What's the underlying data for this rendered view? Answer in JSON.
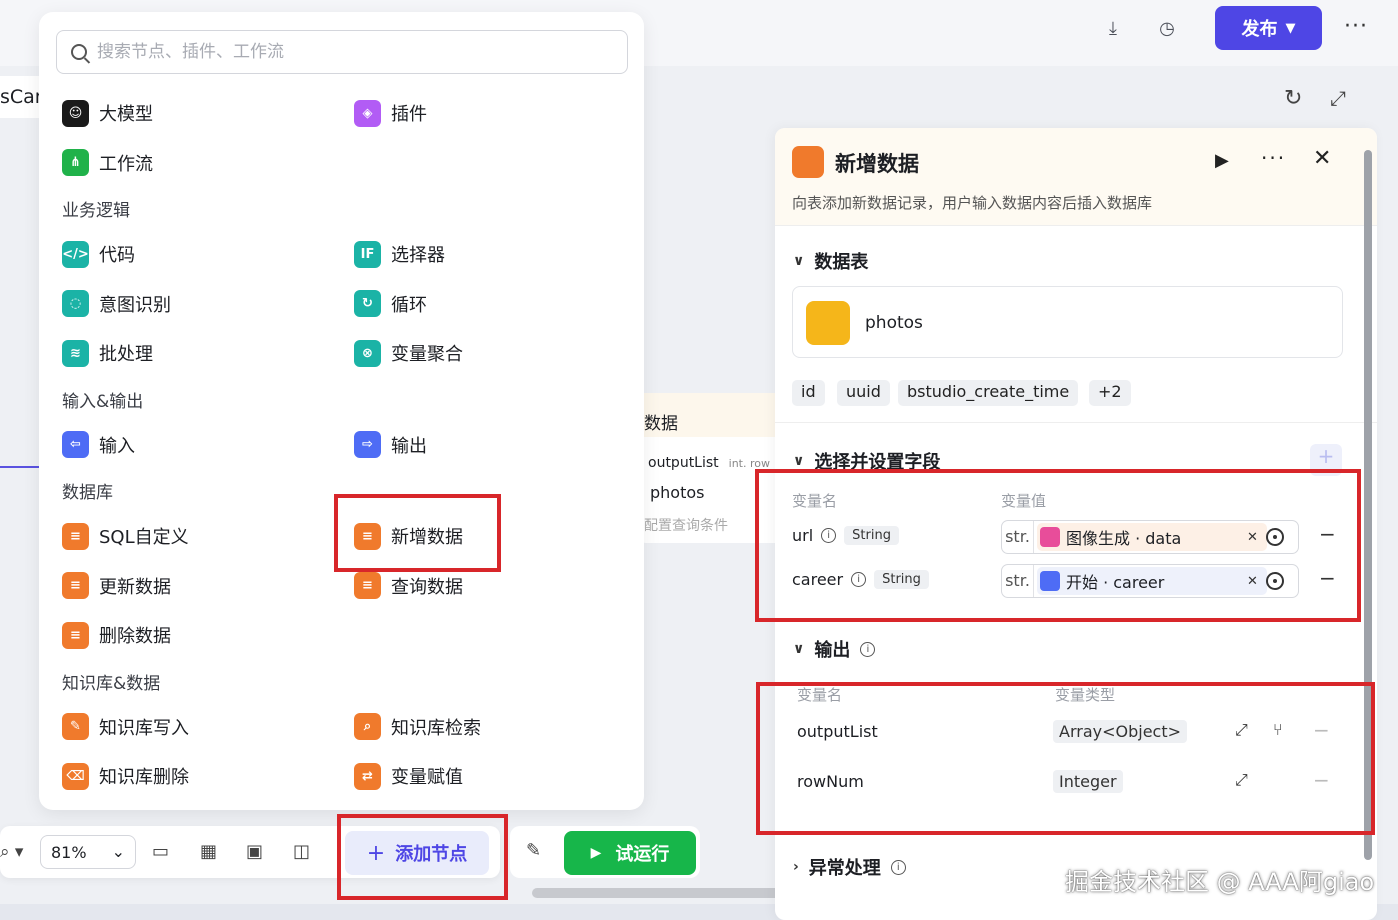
{
  "topbar": {
    "publish_label": "发布",
    "more": "···",
    "icons": [
      "save-draft-icon",
      "history-icon"
    ]
  },
  "canvas": {
    "left_node_fragment": "sCar",
    "mid_node": {
      "title_fragment": "数据",
      "output": "outputList",
      "output_type": "int. row",
      "table": "photos",
      "hint": "配置查询条件"
    }
  },
  "node_menu": {
    "search_placeholder": "搜索节点、插件、工作流",
    "top": [
      {
        "label": "大模型",
        "icon": "llm-icon",
        "glyph": "☺",
        "color": "c-black"
      },
      {
        "label": "插件",
        "icon": "plugin-icon",
        "glyph": "◈",
        "color": "c-purple"
      },
      {
        "label": "工作流",
        "icon": "workflow-icon",
        "glyph": "⋔",
        "color": "c-green"
      }
    ],
    "sections": [
      {
        "title": "业务逻辑",
        "items": [
          {
            "label": "代码",
            "icon": "code-icon",
            "glyph": "</>",
            "color": "c-teal"
          },
          {
            "label": "选择器",
            "icon": "selector-icon",
            "glyph": "IF",
            "color": "c-teal"
          },
          {
            "label": "意图识别",
            "icon": "intent-icon",
            "glyph": "◌",
            "color": "c-teal"
          },
          {
            "label": "循环",
            "icon": "loop-icon",
            "glyph": "↻",
            "color": "c-teal"
          },
          {
            "label": "批处理",
            "icon": "batch-icon",
            "glyph": "≋",
            "color": "c-teal"
          },
          {
            "label": "变量聚合",
            "icon": "aggregate-icon",
            "glyph": "⊗",
            "color": "c-teal"
          }
        ]
      },
      {
        "title": "输入&输出",
        "items": [
          {
            "label": "输入",
            "icon": "input-icon",
            "glyph": "⇦",
            "color": "c-blue"
          },
          {
            "label": "输出",
            "icon": "output-icon",
            "glyph": "⇨",
            "color": "c-blue"
          }
        ]
      },
      {
        "title": "数据库",
        "items": [
          {
            "label": "SQL自定义",
            "icon": "sql-icon",
            "glyph": "≡",
            "color": "c-orange"
          },
          {
            "label": "新增数据",
            "icon": "db-insert-icon",
            "glyph": "≡",
            "color": "c-orange"
          },
          {
            "label": "更新数据",
            "icon": "db-update-icon",
            "glyph": "≡",
            "color": "c-orange"
          },
          {
            "label": "查询数据",
            "icon": "db-query-icon",
            "glyph": "≡",
            "color": "c-orange"
          },
          {
            "label": "删除数据",
            "icon": "db-delete-icon",
            "glyph": "≡",
            "color": "c-orange"
          }
        ]
      },
      {
        "title": "知识库&数据",
        "items": [
          {
            "label": "知识库写入",
            "icon": "kb-write-icon",
            "glyph": "✎",
            "color": "c-orange"
          },
          {
            "label": "知识库检索",
            "icon": "kb-search-icon",
            "glyph": "⌕",
            "color": "c-orange"
          },
          {
            "label": "知识库删除",
            "icon": "kb-delete-icon",
            "glyph": "⌫",
            "color": "c-orange"
          },
          {
            "label": "变量赋值",
            "icon": "assign-icon",
            "glyph": "⇄",
            "color": "c-orange"
          }
        ]
      }
    ]
  },
  "bottombar": {
    "zoom": "81%",
    "add_node_label": "添加节点",
    "run_label": "试运行"
  },
  "panel": {
    "title": "新增数据",
    "description": "向表添加新数据记录，用户输入数据内容后插入数据库",
    "table_section": "数据表",
    "table_name": "photos",
    "columns": [
      "id",
      "uuid",
      "bstudio_create_time",
      "+2"
    ],
    "fields_section": "选择并设置字段",
    "var_name_header": "变量名",
    "var_value_header": "变量值",
    "fields": [
      {
        "name": "url",
        "type": "String",
        "prefix": "str.",
        "ref": "图像生成 · data",
        "ref_color": "#e84d9a",
        "ref_bg": "#fdf0e6"
      },
      {
        "name": "career",
        "type": "String",
        "prefix": "str.",
        "ref": "开始 · career",
        "ref_color": "#4e6cf5",
        "ref_bg": "#eef1fb"
      }
    ],
    "output_section": "输出",
    "out_name_header": "变量名",
    "out_type_header": "变量类型",
    "outputs": [
      {
        "name": "outputList",
        "type": "Array<Object>"
      },
      {
        "name": "rowNum",
        "type": "Integer"
      }
    ],
    "error_section": "异常处理"
  },
  "watermark": "掘金技术社区 @ AAA阿giao",
  "colors": {
    "accent": "#4e46e5",
    "run_green": "#17b64a",
    "highlight_red": "#d8262a"
  }
}
